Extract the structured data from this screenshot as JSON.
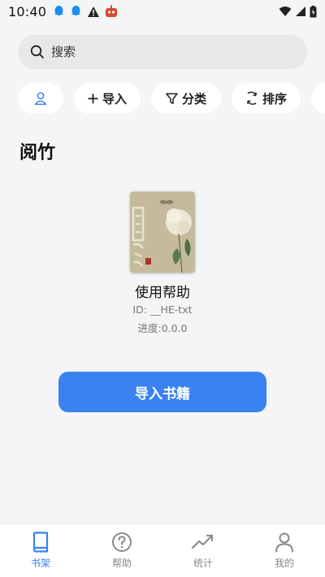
{
  "status_bar": {
    "time": "10:40"
  },
  "search": {
    "placeholder": "搜索"
  },
  "chips": {
    "import_label": "导入",
    "category_label": "分类",
    "sort_label": "排序"
  },
  "library": {
    "title": "阅竹"
  },
  "book": {
    "title": "使用帮助",
    "id_text": "ID: __HE-txt",
    "progress_text": "进度:0.0.0"
  },
  "import_button": {
    "label": "导入书籍"
  },
  "bottom_nav": {
    "items": [
      {
        "label": "书架",
        "icon": "book-icon",
        "active": true
      },
      {
        "label": "帮助",
        "icon": "help-icon",
        "active": false
      },
      {
        "label": "统计",
        "icon": "trend-icon",
        "active": false
      },
      {
        "label": "我的",
        "icon": "person-icon",
        "active": false
      }
    ]
  },
  "colors": {
    "accent": "#3a82ef",
    "background": "#f4f5f7",
    "search_bg": "#e7e8ea",
    "nav_inactive": "#888888"
  }
}
